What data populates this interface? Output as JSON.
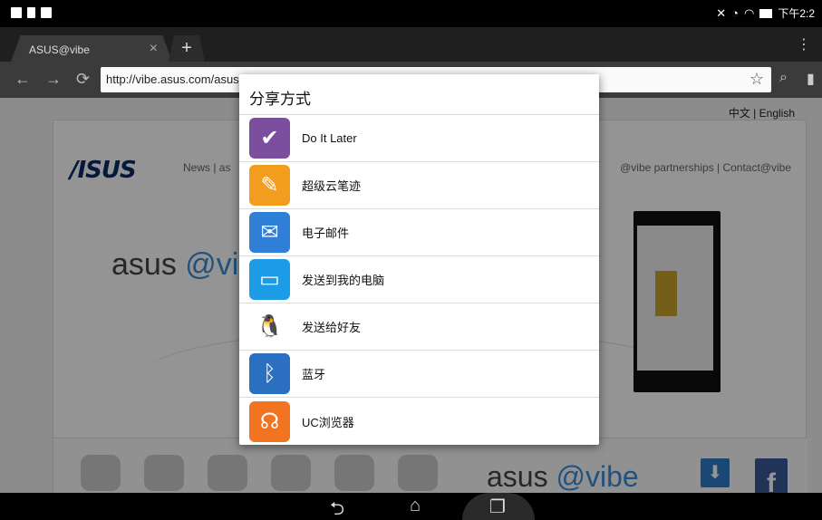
{
  "status_bar": {
    "time": "下午2:2"
  },
  "browser": {
    "tab_title": "ASUS@vibe",
    "tab_close": "×",
    "new_tab": "+",
    "url": "http://vibe.asus.com/asus",
    "icons": [
      "back-icon",
      "forward-icon",
      "reload-icon",
      "star-icon",
      "search-icon",
      "bookmark-icon",
      "overflow-menu-icon"
    ]
  },
  "page": {
    "lang_cn": "中文",
    "lang_sep": "|",
    "lang_en": "English",
    "logo": "/ISUS",
    "nav_left": "News | as",
    "nav_right": "@vibe partnerships  |  Contact@vibe",
    "hero_text": "asus",
    "hero_at": "@vi",
    "bottom_text": "asus",
    "bottom_at": "@vibe",
    "download_glyph": "⬇",
    "facebook_glyph": "f"
  },
  "share_dialog": {
    "title": "分享方式",
    "options": [
      {
        "label": "Do It Later",
        "icon": "checkmark-icon",
        "color": "#7b4f9e",
        "glyph": "✔"
      },
      {
        "label": "超级云笔迹",
        "icon": "pen-icon",
        "color": "#f29d1d",
        "glyph": "✎"
      },
      {
        "label": "电子邮件",
        "icon": "mail-icon",
        "color": "#2f7fd6",
        "glyph": "✉"
      },
      {
        "label": "发送到我的电脑",
        "icon": "monitor-icon",
        "color": "#1c9be6",
        "glyph": "▭"
      },
      {
        "label": "发送给好友",
        "icon": "qq-penguin-icon",
        "color": "#ffffff",
        "glyph": "🐧"
      },
      {
        "label": "蓝牙",
        "icon": "bluetooth-icon",
        "color": "#2a6fc0",
        "glyph": "ᛒ"
      },
      {
        "label": "UC浏览器",
        "icon": "uc-browser-icon",
        "color": "#f27421",
        "glyph": "☊"
      }
    ]
  },
  "nav_bar": {
    "back": "⮌",
    "home": "⌂",
    "recents": "❐"
  }
}
